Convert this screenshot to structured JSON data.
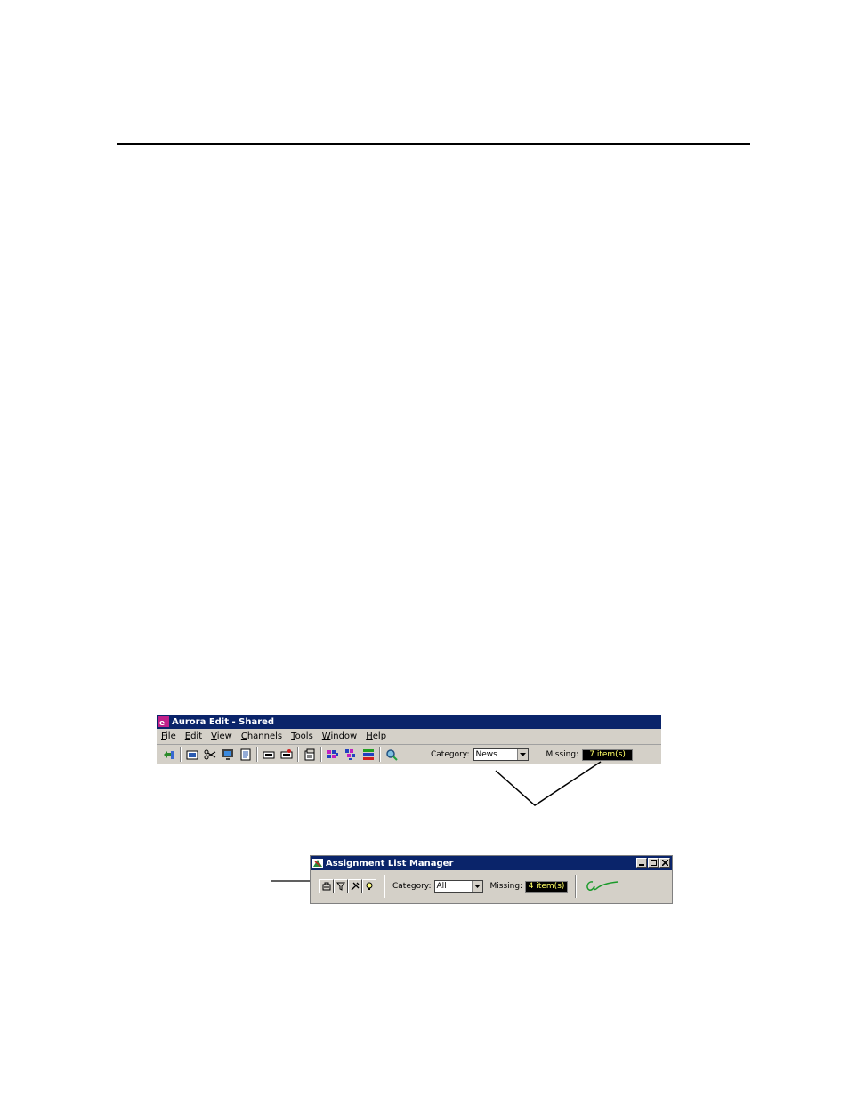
{
  "aurora_window": {
    "title": "Aurora Edit - Shared",
    "menu": [
      {
        "accel": "F",
        "rest": "ile"
      },
      {
        "accel": "E",
        "rest": "dit"
      },
      {
        "accel": "V",
        "rest": "iew"
      },
      {
        "accel": "C",
        "rest": "hannels"
      },
      {
        "accel": "T",
        "rest": "ools"
      },
      {
        "accel": "W",
        "rest": "indow"
      },
      {
        "accel": "H",
        "rest": "elp"
      }
    ],
    "category_label": "Category:",
    "category_value": "News",
    "missing_label": "Missing:",
    "missing_value": "7 item(s)"
  },
  "alm_window": {
    "title": "Assignment List Manager",
    "category_label": "Category:",
    "category_value": "All",
    "missing_label": "Missing:",
    "missing_value": "4 item(s)"
  },
  "icons": {
    "aurora_app": "aurora-app-icon",
    "alm_app": "assignment-list-app-icon",
    "logo": "grass-valley-logo"
  },
  "colors": {
    "titlebar": "#0a246a",
    "chrome": "#d4d0c8",
    "missing_text": "#ffff66",
    "logo_green": "#1a9a2a"
  }
}
